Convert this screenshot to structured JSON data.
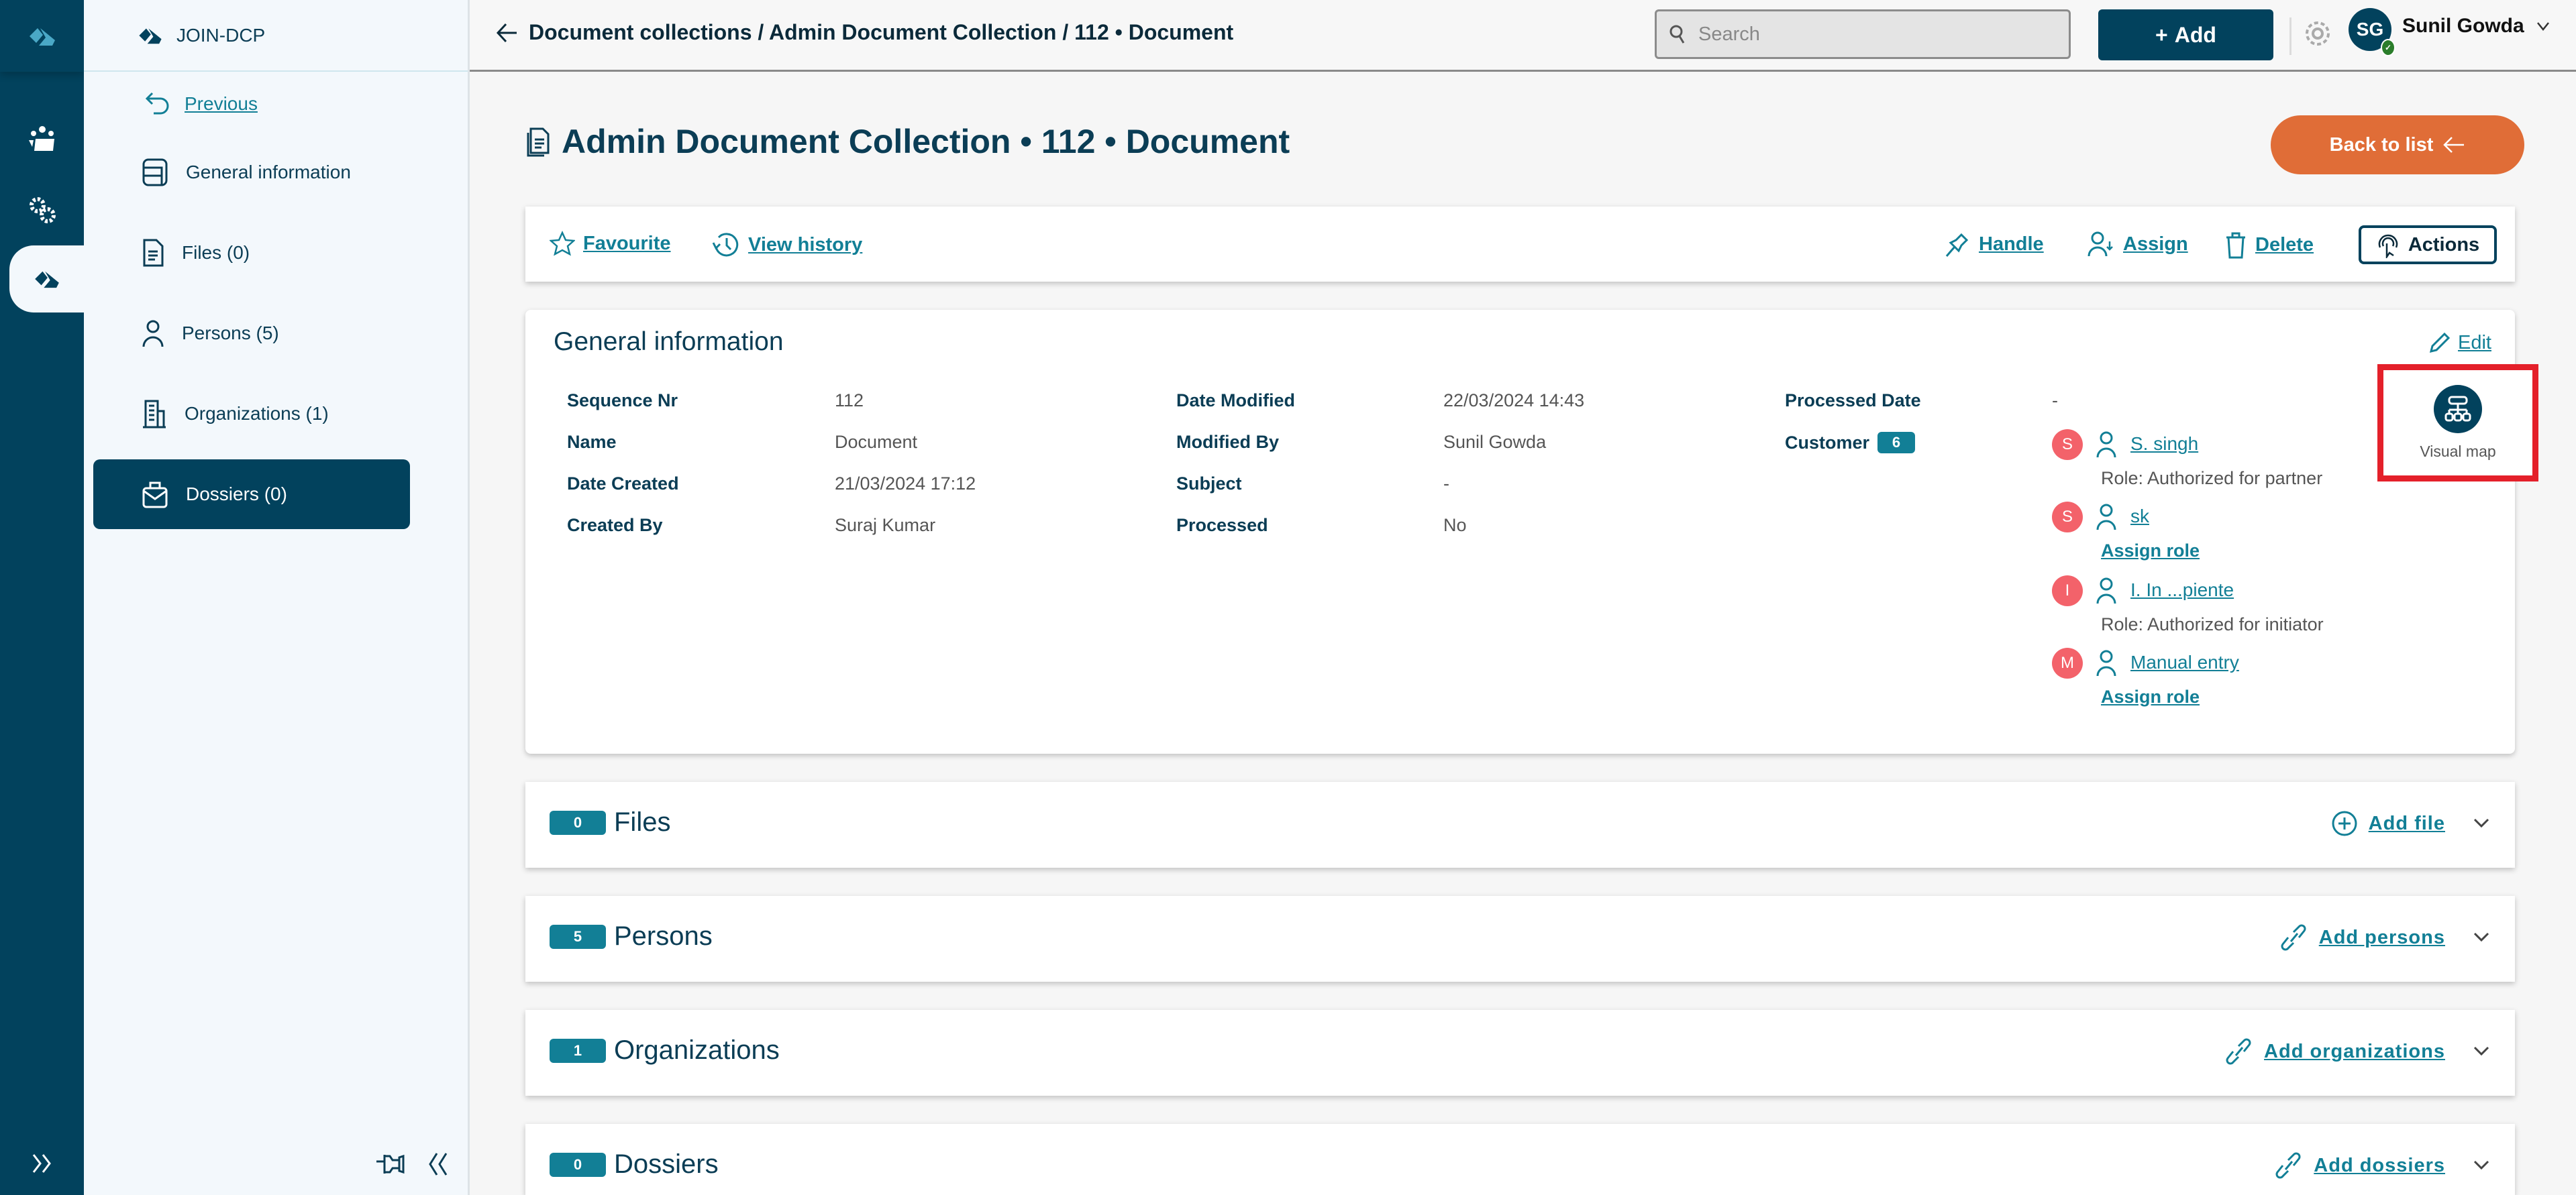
{
  "app": {
    "name": "JOIN-DCP"
  },
  "rail": {
    "items": [
      {
        "icon": "team-icon"
      },
      {
        "icon": "settings-icon"
      },
      {
        "icon": "dcp-logo-icon",
        "active": true
      }
    ],
    "expand_icon": "double-chevron-right-icon"
  },
  "panel": {
    "previous": "Previous",
    "items": [
      {
        "label": "General information",
        "icon": "info-card-icon",
        "active": false
      },
      {
        "label": "Files (0)",
        "icon": "file-icon",
        "active": false
      },
      {
        "label": "Persons (5)",
        "icon": "person-icon",
        "active": false
      },
      {
        "label": "Organizations (1)",
        "icon": "building-icon",
        "active": false
      },
      {
        "label": "Dossiers (0)",
        "icon": "briefcase-icon",
        "active": true
      }
    ]
  },
  "header": {
    "breadcrumb": "Document collections / Admin Document Collection / 112 • Document",
    "search_placeholder": "Search",
    "add_label": "Add",
    "user_initials": "SG",
    "user_name": "Sunil Gowda"
  },
  "page": {
    "title": "Admin Document Collection • 112 • Document",
    "back_label": "Back to list"
  },
  "toolbar": {
    "favourite": "Favourite",
    "view_history": "View history",
    "handle": "Handle",
    "assign": "Assign",
    "delete": "Delete",
    "actions": "Actions"
  },
  "general": {
    "title": "General information",
    "edit": "Edit",
    "col1": [
      {
        "label": "Sequence Nr",
        "value": "112"
      },
      {
        "label": "Name",
        "value": "Document"
      },
      {
        "label": "Date Created",
        "value": "21/03/2024 17:12"
      },
      {
        "label": "Created By",
        "value": "Suraj Kumar"
      }
    ],
    "col2": [
      {
        "label": "Date Modified",
        "value": "22/03/2024 14:43"
      },
      {
        "label": "Modified By",
        "value": "Sunil Gowda"
      },
      {
        "label": "Subject",
        "value": "-"
      },
      {
        "label": "Processed",
        "value": "No"
      }
    ],
    "processed_date": {
      "label": "Processed Date",
      "value": "-"
    },
    "customer": {
      "label": "Customer",
      "count": "6",
      "persons": [
        {
          "initial": "S",
          "name": "S. singh",
          "role": "Role: Authorized for partner"
        },
        {
          "initial": "S",
          "name": "sk",
          "assign": "Assign role"
        },
        {
          "initial": "I",
          "name": "I. In ...piente",
          "role": "Role: Authorized for initiator"
        },
        {
          "initial": "M",
          "name": "Manual entry",
          "assign": "Assign role"
        }
      ]
    },
    "visual_map": "Visual map"
  },
  "sections": [
    {
      "count": "0",
      "title": "Files",
      "action": "Add file",
      "icon": "plus-circle-icon"
    },
    {
      "count": "5",
      "title": "Persons",
      "action": "Add persons",
      "icon": "link-icon"
    },
    {
      "count": "1",
      "title": "Organizations",
      "action": "Add organizations",
      "icon": "link-icon"
    },
    {
      "count": "0",
      "title": "Dossiers",
      "action": "Add dossiers",
      "icon": "link-icon"
    }
  ],
  "colors": {
    "primary": "#02425d",
    "link": "#127f96",
    "accent": "#e06d37",
    "avatar": "#f3626a",
    "highlight": "#e4202a"
  }
}
